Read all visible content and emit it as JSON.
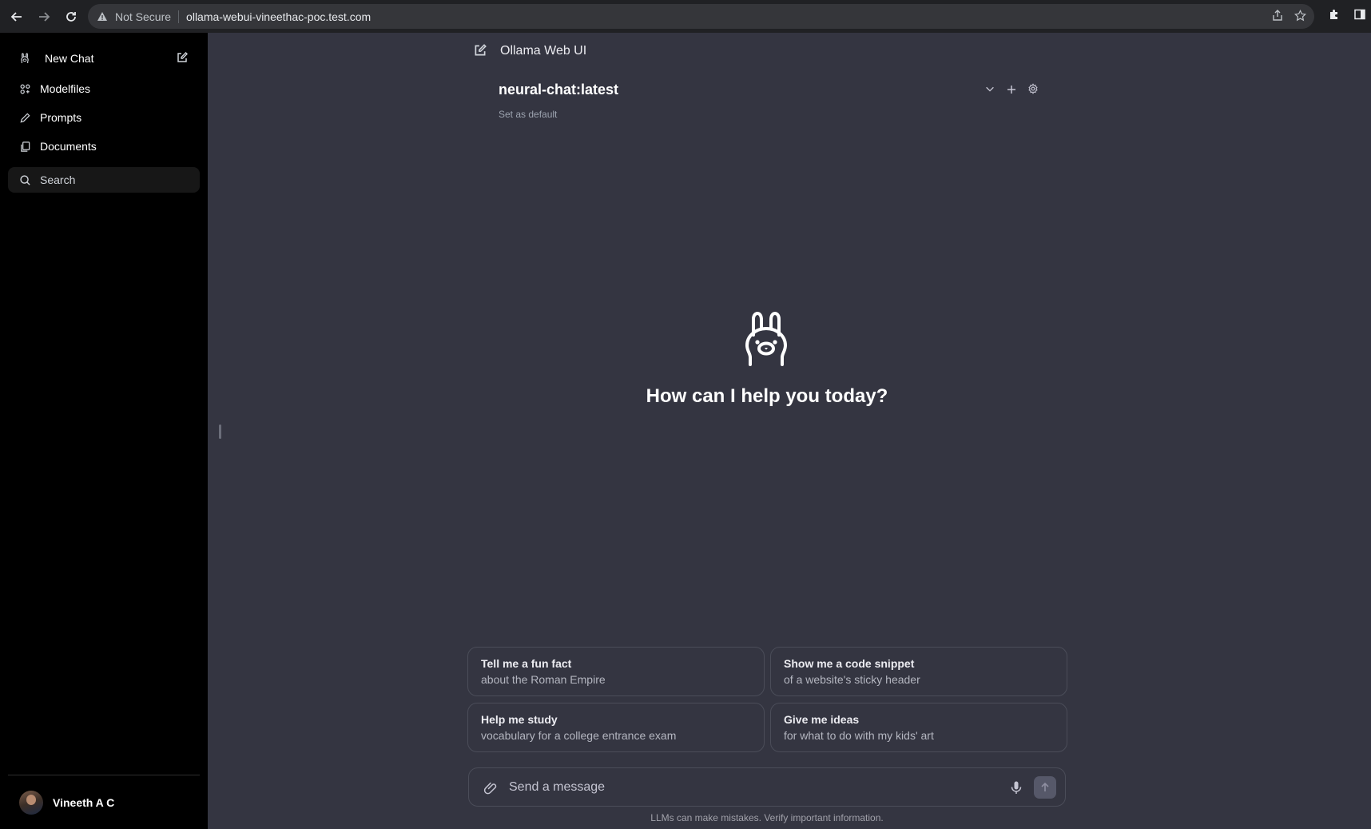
{
  "browser": {
    "security_label": "Not Secure",
    "url": "ollama-webui-vineethac-poc.test.com"
  },
  "sidebar": {
    "new_chat": "New Chat",
    "items": [
      {
        "label": "Modelfiles",
        "icon": "modelfiles-icon"
      },
      {
        "label": "Prompts",
        "icon": "pencil-icon"
      },
      {
        "label": "Documents",
        "icon": "documents-icon"
      }
    ],
    "search_placeholder": "Search",
    "user_name": "Vineeth A C"
  },
  "header": {
    "title": "Ollama Web UI"
  },
  "model": {
    "name": "neural-chat:latest",
    "set_default": "Set as default"
  },
  "hero": {
    "greeting": "How can I help you today?"
  },
  "suggestions": [
    {
      "title": "Tell me a fun fact",
      "subtitle": "about the Roman Empire"
    },
    {
      "title": "Show me a code snippet",
      "subtitle": "of a website's sticky header"
    },
    {
      "title": "Help me study",
      "subtitle": "vocabulary for a college entrance exam"
    },
    {
      "title": "Give me ideas",
      "subtitle": "for what to do with my kids' art"
    }
  ],
  "composer": {
    "placeholder": "Send a message"
  },
  "footer": {
    "disclaimer": "LLMs can make mistakes. Verify important information."
  },
  "colors": {
    "sidebar_bg": "#000000",
    "main_bg": "#343541",
    "border": "#4b4d59"
  }
}
